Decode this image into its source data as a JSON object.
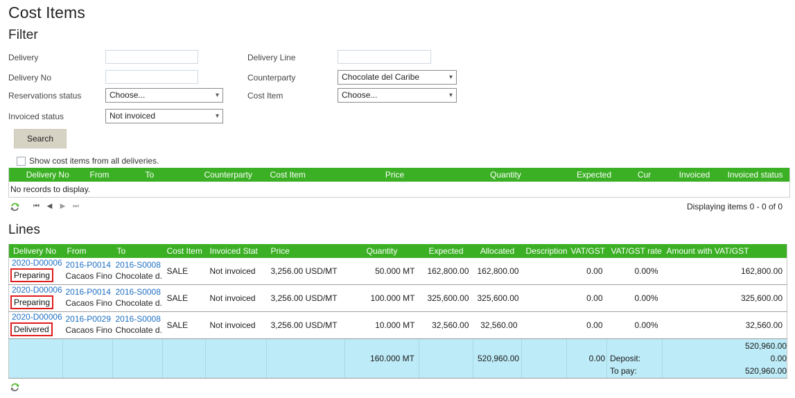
{
  "page": {
    "title": "Cost Items",
    "filter_heading": "Filter",
    "lines_heading": "Lines"
  },
  "filter": {
    "left": [
      {
        "label": "Delivery",
        "type": "text",
        "value": "",
        "placeholder": ""
      },
      {
        "label": "Delivery No",
        "type": "text",
        "value": "",
        "placeholder": ""
      },
      {
        "label": "Reservations status",
        "type": "select",
        "value": "Choose..."
      },
      {
        "label": "Invoiced status",
        "type": "select",
        "value": "Not invoiced"
      }
    ],
    "right": [
      {
        "label": "Delivery Line",
        "type": "text",
        "value": "",
        "placeholder": ""
      },
      {
        "label": "Counterparty",
        "type": "select",
        "value": "Chocolate del Caribe"
      },
      {
        "label": "Cost Item",
        "type": "select",
        "value": "Choose..."
      }
    ],
    "search_label": "Search",
    "show_all_label": "Show cost items from all deliveries.",
    "show_all_checked": false
  },
  "cost_items_grid": {
    "columns": [
      "Delivery No",
      "From",
      "To",
      "Counterparty",
      "Cost Item",
      "Price",
      "Quantity",
      "Expected",
      "Cur",
      "Invoiced",
      "Invoiced status"
    ],
    "empty_message": "No records to display.",
    "pager": {
      "first": "⏮",
      "prev": "◀",
      "next": "▶",
      "last": "⏭",
      "count_text": "Displaying items 0 - 0 of 0"
    }
  },
  "lines_grid": {
    "columns": [
      "Delivery No",
      "From",
      "To",
      "Cost Item",
      "Invoiced Stat",
      "Price",
      "Quantity",
      "Expected",
      "Allocated",
      "Description",
      "VAT/GST",
      "VAT/GST rate",
      "Amount with VAT/GST"
    ],
    "rows": [
      {
        "delivery_no": "2020-D00006",
        "status_badge": "Preparing",
        "from_link": "2016-P0014",
        "from_sub": "Cacaos Fino...",
        "to_link": "2016-S0008",
        "to_sub": "Chocolate d...",
        "cost_item": "SALE",
        "invoiced_status": "Not invoiced",
        "price": "3,256.00 USD/MT",
        "quantity": "50.000 MT",
        "expected": "162,800.00",
        "allocated": "162,800.00",
        "description": "",
        "vat_gst": "0.00",
        "vat_gst_rate": "0.00%",
        "amount_with_vat": "162,800.00"
      },
      {
        "delivery_no": "2020-D00006",
        "status_badge": "Preparing",
        "from_link": "2016-P0014",
        "from_sub": "Cacaos Fino...",
        "to_link": "2016-S0008",
        "to_sub": "Chocolate d...",
        "cost_item": "SALE",
        "invoiced_status": "Not invoiced",
        "price": "3,256.00 USD/MT",
        "quantity": "100.000 MT",
        "expected": "325,600.00",
        "allocated": "325,600.00",
        "description": "",
        "vat_gst": "0.00",
        "vat_gst_rate": "0.00%",
        "amount_with_vat": "325,600.00"
      },
      {
        "delivery_no": "2020-D00006",
        "status_badge": "Delivered",
        "from_link": "2016-P0029",
        "from_sub": "Cacaos Fino...",
        "to_link": "2016-S0008",
        "to_sub": "Chocolate d...",
        "cost_item": "SALE",
        "invoiced_status": "Not invoiced",
        "price": "3,256.00 USD/MT",
        "quantity": "10.000 MT",
        "expected": "32,560.00",
        "allocated": "32,560.00",
        "description": "",
        "vat_gst": "0.00",
        "vat_gst_rate": "0.00%",
        "amount_with_vat": "32,560.00"
      }
    ],
    "summary": {
      "quantity_total": "160.000 MT",
      "allocated_total": "520,960.00",
      "vat_total": "0.00",
      "amount_total": "520,960.00",
      "deposit_label": "Deposit:",
      "deposit_value": "0.00",
      "to_pay_label": "To pay:",
      "to_pay_value": "520,960.00"
    }
  },
  "colors": {
    "header_green": "#3bb024",
    "summary_blue": "#bdebf7",
    "link_blue": "#1f6fc4",
    "badge_red": "#e01b1b",
    "button_grey": "#d6d2c4"
  }
}
